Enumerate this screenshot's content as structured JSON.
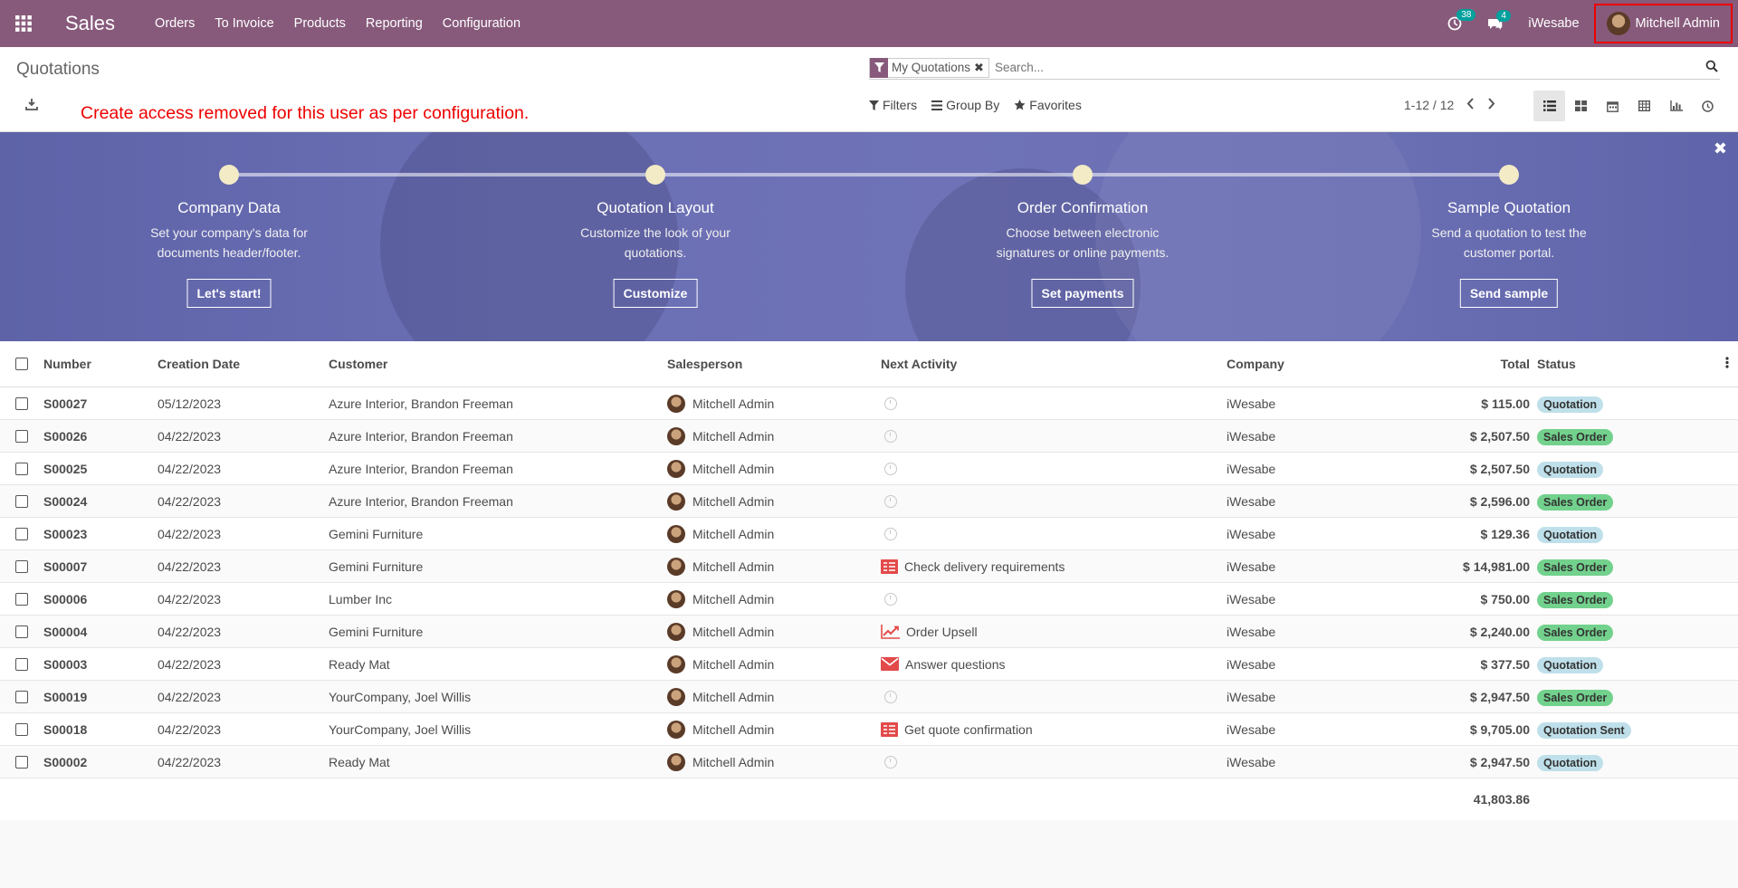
{
  "topbar": {
    "app_name": "Sales",
    "menu": [
      "Orders",
      "To Invoice",
      "Products",
      "Reporting",
      "Configuration"
    ],
    "activity_count": "38",
    "message_count": "4",
    "company": "iWesabe",
    "user": "Mitchell Admin",
    "bg_color": "#875a7b"
  },
  "control": {
    "breadcrumb": "Quotations",
    "warning": "Create access removed for this user as per configuration.",
    "facet": "My Quotations",
    "search_placeholder": "Search...",
    "filters": "Filters",
    "group_by": "Group By",
    "favorites": "Favorites",
    "pager": "1-12 / 12"
  },
  "banner": {
    "steps": [
      {
        "title": "Company Data",
        "desc": "Set your company's data for documents header/footer.",
        "button": "Let's start!"
      },
      {
        "title": "Quotation Layout",
        "desc": "Customize the look of your quotations.",
        "button": "Customize"
      },
      {
        "title": "Order Confirmation",
        "desc": "Choose between electronic signatures or online payments.",
        "button": "Set payments"
      },
      {
        "title": "Sample Quotation",
        "desc": "Send a quotation to test the customer portal.",
        "button": "Send sample"
      }
    ]
  },
  "table": {
    "headers": {
      "number": "Number",
      "date": "Creation Date",
      "customer": "Customer",
      "salesperson": "Salesperson",
      "activity": "Next Activity",
      "company": "Company",
      "total": "Total",
      "status": "Status"
    },
    "rows": [
      {
        "number": "S00027",
        "date": "05/12/2023",
        "customer": "Azure Interior, Brandon Freeman",
        "salesperson": "Mitchell Admin",
        "activity": "",
        "activity_icon": "clock-icon",
        "company": "iWesabe",
        "total": "$ 115.00",
        "status": "Quotation",
        "status_type": "quotation"
      },
      {
        "number": "S00026",
        "date": "04/22/2023",
        "customer": "Azure Interior, Brandon Freeman",
        "salesperson": "Mitchell Admin",
        "activity": "",
        "activity_icon": "clock-icon",
        "company": "iWesabe",
        "total": "$ 2,507.50",
        "status": "Sales Order",
        "status_type": "sales"
      },
      {
        "number": "S00025",
        "date": "04/22/2023",
        "customer": "Azure Interior, Brandon Freeman",
        "salesperson": "Mitchell Admin",
        "activity": "",
        "activity_icon": "clock-icon",
        "company": "iWesabe",
        "total": "$ 2,507.50",
        "status": "Quotation",
        "status_type": "quotation"
      },
      {
        "number": "S00024",
        "date": "04/22/2023",
        "customer": "Azure Interior, Brandon Freeman",
        "salesperson": "Mitchell Admin",
        "activity": "",
        "activity_icon": "clock-icon",
        "company": "iWesabe",
        "total": "$ 2,596.00",
        "status": "Sales Order",
        "status_type": "sales"
      },
      {
        "number": "S00023",
        "date": "04/22/2023",
        "customer": "Gemini Furniture",
        "salesperson": "Mitchell Admin",
        "activity": "",
        "activity_icon": "clock-icon",
        "company": "iWesabe",
        "total": "$ 129.36",
        "status": "Quotation",
        "status_type": "quotation"
      },
      {
        "number": "S00007",
        "date": "04/22/2023",
        "customer": "Gemini Furniture",
        "salesperson": "Mitchell Admin",
        "activity": "Check delivery requirements",
        "activity_icon": "tasks-icon",
        "company": "iWesabe",
        "total": "$ 14,981.00",
        "status": "Sales Order",
        "status_type": "sales"
      },
      {
        "number": "S00006",
        "date": "04/22/2023",
        "customer": "Lumber Inc",
        "salesperson": "Mitchell Admin",
        "activity": "",
        "activity_icon": "clock-icon",
        "company": "iWesabe",
        "total": "$ 750.00",
        "status": "Sales Order",
        "status_type": "sales"
      },
      {
        "number": "S00004",
        "date": "04/22/2023",
        "customer": "Gemini Furniture",
        "salesperson": "Mitchell Admin",
        "activity": "Order Upsell",
        "activity_icon": "line-chart-icon",
        "company": "iWesabe",
        "total": "$ 2,240.00",
        "status": "Sales Order",
        "status_type": "sales"
      },
      {
        "number": "S00003",
        "date": "04/22/2023",
        "customer": "Ready Mat",
        "salesperson": "Mitchell Admin",
        "activity": "Answer questions",
        "activity_icon": "envelope-icon",
        "company": "iWesabe",
        "total": "$ 377.50",
        "status": "Quotation",
        "status_type": "quotation"
      },
      {
        "number": "S00019",
        "date": "04/22/2023",
        "customer": "YourCompany, Joel Willis",
        "salesperson": "Mitchell Admin",
        "activity": "",
        "activity_icon": "clock-icon",
        "company": "iWesabe",
        "total": "$ 2,947.50",
        "status": "Sales Order",
        "status_type": "sales"
      },
      {
        "number": "S00018",
        "date": "04/22/2023",
        "customer": "YourCompany, Joel Willis",
        "salesperson": "Mitchell Admin",
        "activity": "Get quote confirmation",
        "activity_icon": "tasks-icon",
        "company": "iWesabe",
        "total": "$ 9,705.00",
        "status": "Quotation Sent",
        "status_type": "sent"
      },
      {
        "number": "S00002",
        "date": "04/22/2023",
        "customer": "Ready Mat",
        "salesperson": "Mitchell Admin",
        "activity": "",
        "activity_icon": "clock-icon",
        "company": "iWesabe",
        "total": "$ 2,947.50",
        "status": "Quotation",
        "status_type": "quotation"
      }
    ],
    "grand_total": "41,803.86"
  }
}
